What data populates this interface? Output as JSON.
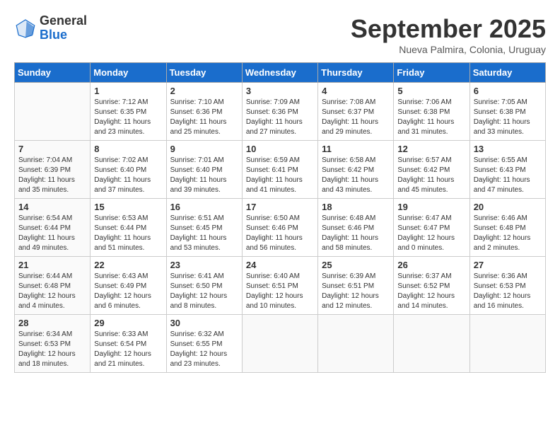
{
  "logo": {
    "general": "General",
    "blue": "Blue"
  },
  "header": {
    "month": "September 2025",
    "location": "Nueva Palmira, Colonia, Uruguay"
  },
  "days": [
    "Sunday",
    "Monday",
    "Tuesday",
    "Wednesday",
    "Thursday",
    "Friday",
    "Saturday"
  ],
  "weeks": [
    [
      {
        "day": "",
        "info": ""
      },
      {
        "day": "1",
        "info": "Sunrise: 7:12 AM\nSunset: 6:35 PM\nDaylight: 11 hours\nand 23 minutes."
      },
      {
        "day": "2",
        "info": "Sunrise: 7:10 AM\nSunset: 6:36 PM\nDaylight: 11 hours\nand 25 minutes."
      },
      {
        "day": "3",
        "info": "Sunrise: 7:09 AM\nSunset: 6:36 PM\nDaylight: 11 hours\nand 27 minutes."
      },
      {
        "day": "4",
        "info": "Sunrise: 7:08 AM\nSunset: 6:37 PM\nDaylight: 11 hours\nand 29 minutes."
      },
      {
        "day": "5",
        "info": "Sunrise: 7:06 AM\nSunset: 6:38 PM\nDaylight: 11 hours\nand 31 minutes."
      },
      {
        "day": "6",
        "info": "Sunrise: 7:05 AM\nSunset: 6:38 PM\nDaylight: 11 hours\nand 33 minutes."
      }
    ],
    [
      {
        "day": "7",
        "info": "Sunrise: 7:04 AM\nSunset: 6:39 PM\nDaylight: 11 hours\nand 35 minutes."
      },
      {
        "day": "8",
        "info": "Sunrise: 7:02 AM\nSunset: 6:40 PM\nDaylight: 11 hours\nand 37 minutes."
      },
      {
        "day": "9",
        "info": "Sunrise: 7:01 AM\nSunset: 6:40 PM\nDaylight: 11 hours\nand 39 minutes."
      },
      {
        "day": "10",
        "info": "Sunrise: 6:59 AM\nSunset: 6:41 PM\nDaylight: 11 hours\nand 41 minutes."
      },
      {
        "day": "11",
        "info": "Sunrise: 6:58 AM\nSunset: 6:42 PM\nDaylight: 11 hours\nand 43 minutes."
      },
      {
        "day": "12",
        "info": "Sunrise: 6:57 AM\nSunset: 6:42 PM\nDaylight: 11 hours\nand 45 minutes."
      },
      {
        "day": "13",
        "info": "Sunrise: 6:55 AM\nSunset: 6:43 PM\nDaylight: 11 hours\nand 47 minutes."
      }
    ],
    [
      {
        "day": "14",
        "info": "Sunrise: 6:54 AM\nSunset: 6:44 PM\nDaylight: 11 hours\nand 49 minutes."
      },
      {
        "day": "15",
        "info": "Sunrise: 6:53 AM\nSunset: 6:44 PM\nDaylight: 11 hours\nand 51 minutes."
      },
      {
        "day": "16",
        "info": "Sunrise: 6:51 AM\nSunset: 6:45 PM\nDaylight: 11 hours\nand 53 minutes."
      },
      {
        "day": "17",
        "info": "Sunrise: 6:50 AM\nSunset: 6:46 PM\nDaylight: 11 hours\nand 56 minutes."
      },
      {
        "day": "18",
        "info": "Sunrise: 6:48 AM\nSunset: 6:46 PM\nDaylight: 11 hours\nand 58 minutes."
      },
      {
        "day": "19",
        "info": "Sunrise: 6:47 AM\nSunset: 6:47 PM\nDaylight: 12 hours\nand 0 minutes."
      },
      {
        "day": "20",
        "info": "Sunrise: 6:46 AM\nSunset: 6:48 PM\nDaylight: 12 hours\nand 2 minutes."
      }
    ],
    [
      {
        "day": "21",
        "info": "Sunrise: 6:44 AM\nSunset: 6:48 PM\nDaylight: 12 hours\nand 4 minutes."
      },
      {
        "day": "22",
        "info": "Sunrise: 6:43 AM\nSunset: 6:49 PM\nDaylight: 12 hours\nand 6 minutes."
      },
      {
        "day": "23",
        "info": "Sunrise: 6:41 AM\nSunset: 6:50 PM\nDaylight: 12 hours\nand 8 minutes."
      },
      {
        "day": "24",
        "info": "Sunrise: 6:40 AM\nSunset: 6:51 PM\nDaylight: 12 hours\nand 10 minutes."
      },
      {
        "day": "25",
        "info": "Sunrise: 6:39 AM\nSunset: 6:51 PM\nDaylight: 12 hours\nand 12 minutes."
      },
      {
        "day": "26",
        "info": "Sunrise: 6:37 AM\nSunset: 6:52 PM\nDaylight: 12 hours\nand 14 minutes."
      },
      {
        "day": "27",
        "info": "Sunrise: 6:36 AM\nSunset: 6:53 PM\nDaylight: 12 hours\nand 16 minutes."
      }
    ],
    [
      {
        "day": "28",
        "info": "Sunrise: 6:34 AM\nSunset: 6:53 PM\nDaylight: 12 hours\nand 18 minutes."
      },
      {
        "day": "29",
        "info": "Sunrise: 6:33 AM\nSunset: 6:54 PM\nDaylight: 12 hours\nand 21 minutes."
      },
      {
        "day": "30",
        "info": "Sunrise: 6:32 AM\nSunset: 6:55 PM\nDaylight: 12 hours\nand 23 minutes."
      },
      {
        "day": "",
        "info": ""
      },
      {
        "day": "",
        "info": ""
      },
      {
        "day": "",
        "info": ""
      },
      {
        "day": "",
        "info": ""
      }
    ]
  ]
}
